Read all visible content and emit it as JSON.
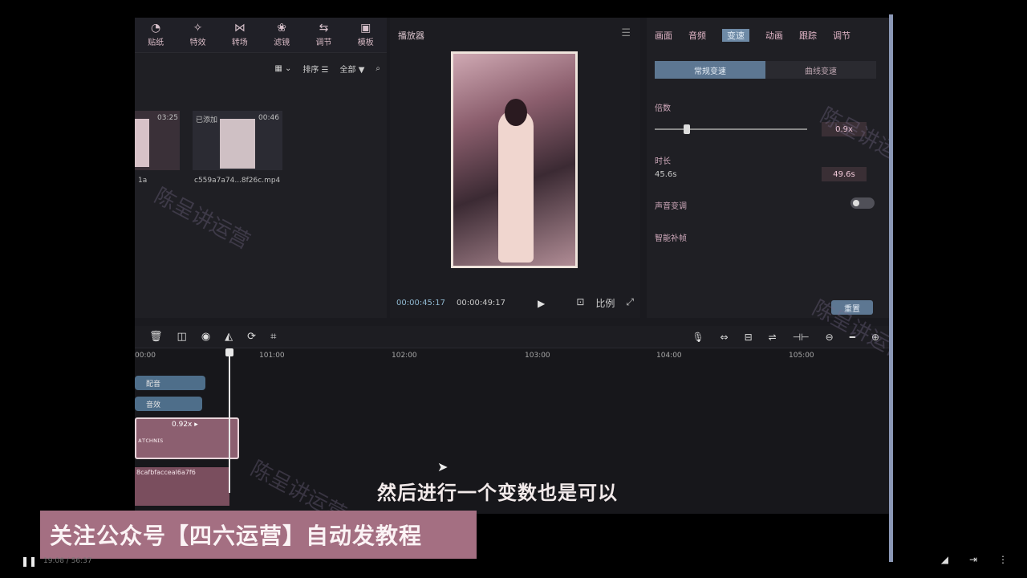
{
  "media": {
    "tabs": [
      {
        "icon": "◔",
        "label": "贴纸"
      },
      {
        "icon": "✧",
        "label": "特效"
      },
      {
        "icon": "⋈",
        "label": "转场"
      },
      {
        "icon": "❀",
        "label": "滤镜"
      },
      {
        "icon": "⇆",
        "label": "调节"
      },
      {
        "icon": "▣",
        "label": "模板"
      }
    ],
    "filters": {
      "view": "▦ ⌄",
      "sort": "排序 ☰",
      "all": "全部 ▼",
      "search": "⌕"
    },
    "items": [
      {
        "duration": "03:25",
        "name": "1a"
      },
      {
        "badge": "已添加",
        "duration": "00:46",
        "name": "c559a7a74...8f26c.mp4"
      }
    ]
  },
  "player": {
    "title": "播放器",
    "current_time": "00:00:45:17",
    "total_time": "00:00:49:17",
    "ratio": "比例"
  },
  "inspector": {
    "tabs": [
      "画面",
      "音频",
      "变速",
      "动画",
      "跟踪",
      "调节"
    ],
    "active_tab": "变速",
    "speed_tabs": [
      "常规变速",
      "曲线变速"
    ],
    "multiplier_label": "倍数",
    "multiplier_value": "0.9x",
    "multiplier_level": 0.2,
    "duration_label": "时长",
    "duration_from": "45.6s",
    "duration_value": "49.6s",
    "pitch_label": "声音变调",
    "smooth_label": "智能补帧",
    "reset_label": "重置"
  },
  "timeline": {
    "ruler": [
      "00:00",
      "101:00",
      "102:00",
      "103:00",
      "104:00",
      "105:00"
    ],
    "tracks": [
      {
        "label": "配音"
      },
      {
        "label": "音效"
      }
    ],
    "main_clip": {
      "speed": "0.92x ▸",
      "name": "ᴀᴛᴄʜɴɪs"
    },
    "lower_clip": {
      "name": "8cafbfacceal6a7f6"
    }
  },
  "overlays": {
    "watermark": "陈呈讲运营",
    "subtitle": "然后进行一个变数也是可以",
    "banner": "关注公众号【四六运营】自动发教程",
    "time_readout": "19:08 / 56:37"
  },
  "colors": {
    "accent": "#5d7792",
    "banner": "#a46f82",
    "clip": "#8c5f70"
  }
}
